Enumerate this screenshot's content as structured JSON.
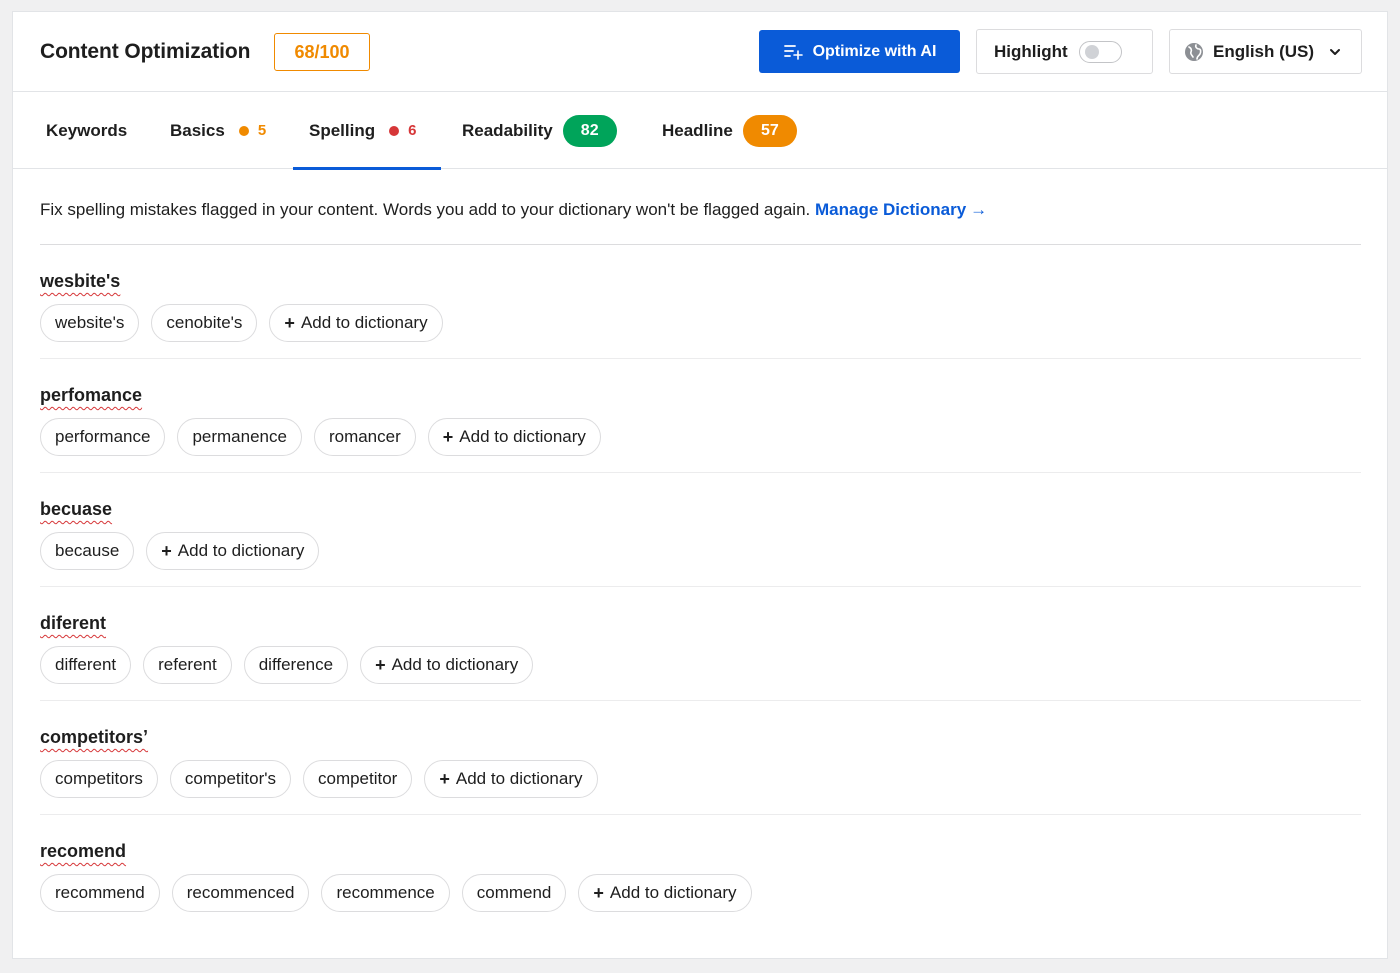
{
  "header": {
    "title": "Content Optimization",
    "score": "68/100",
    "optimize_button": "Optimize with AI",
    "highlight_label": "Highlight",
    "highlight_enabled": false,
    "language": "English (US)"
  },
  "tabs": [
    {
      "label": "Keywords",
      "count": null
    },
    {
      "label": "Basics",
      "count": "5",
      "color": "#f08a00"
    },
    {
      "label": "Spelling",
      "count": "6",
      "color": "#d63638",
      "active": true
    },
    {
      "label": "Readability",
      "badge": "82",
      "color": "#00a45a"
    },
    {
      "label": "Headline",
      "badge": "57",
      "color": "#f08a00"
    }
  ],
  "intro": {
    "text": "Fix spelling mistakes flagged in your content. Words you add to your dictionary won't be flagged again.",
    "link": "Manage Dictionary"
  },
  "add_label": "Add to dictionary",
  "issues": [
    {
      "word": "wesbite's",
      "suggestions": [
        "website's",
        "cenobite's"
      ]
    },
    {
      "word": "perfomance",
      "suggestions": [
        "performance",
        "permanence",
        "romancer"
      ]
    },
    {
      "word": "becuase",
      "suggestions": [
        "because"
      ]
    },
    {
      "word": "diferent",
      "suggestions": [
        "different",
        "referent",
        "difference"
      ]
    },
    {
      "word": "competitors’",
      "suggestions": [
        "competitors",
        "competitor's",
        "competitor"
      ]
    },
    {
      "word": "recomend",
      "suggestions": [
        "recommend",
        "recommenced",
        "recommence",
        "commend"
      ]
    }
  ],
  "colors": {
    "accent": "#0a5bd8",
    "score": "#f08a00",
    "error": "#d63638",
    "good": "#00a45a"
  }
}
